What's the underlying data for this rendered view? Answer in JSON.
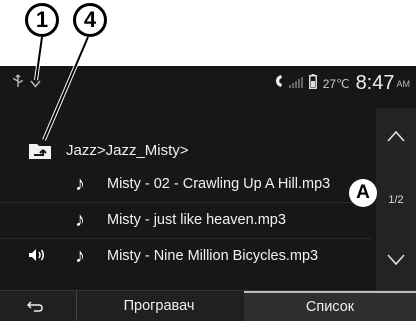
{
  "callouts": {
    "one": "1",
    "four": "4",
    "a": "A"
  },
  "status_bar": {
    "left_icons": [
      "usb-icon",
      "chevron-down-icon"
    ],
    "right_icons": [
      "phone-icon",
      "signal-icon",
      "battery-icon"
    ],
    "temperature": "27℃",
    "time": "8:47",
    "ampm": "AM"
  },
  "browser": {
    "breadcrumb": "Jazz>Jazz_Misty>",
    "tracks": [
      {
        "name": "Misty - 02 - Crawling Up A Hill.mp3",
        "playing": false
      },
      {
        "name": "Misty - just like heaven.mp3",
        "playing": false
      },
      {
        "name": "Misty - Nine Million Bicycles.mp3",
        "playing": true
      }
    ],
    "page": "1/2"
  },
  "tabs": {
    "player": "Програвач",
    "list": "Список",
    "active": "list"
  },
  "colors": {
    "screen_bg": "#171717",
    "tab_bar_bg": "#202020",
    "active_tab_bg": "#2e2e2e",
    "text": "#f2f2f2"
  }
}
